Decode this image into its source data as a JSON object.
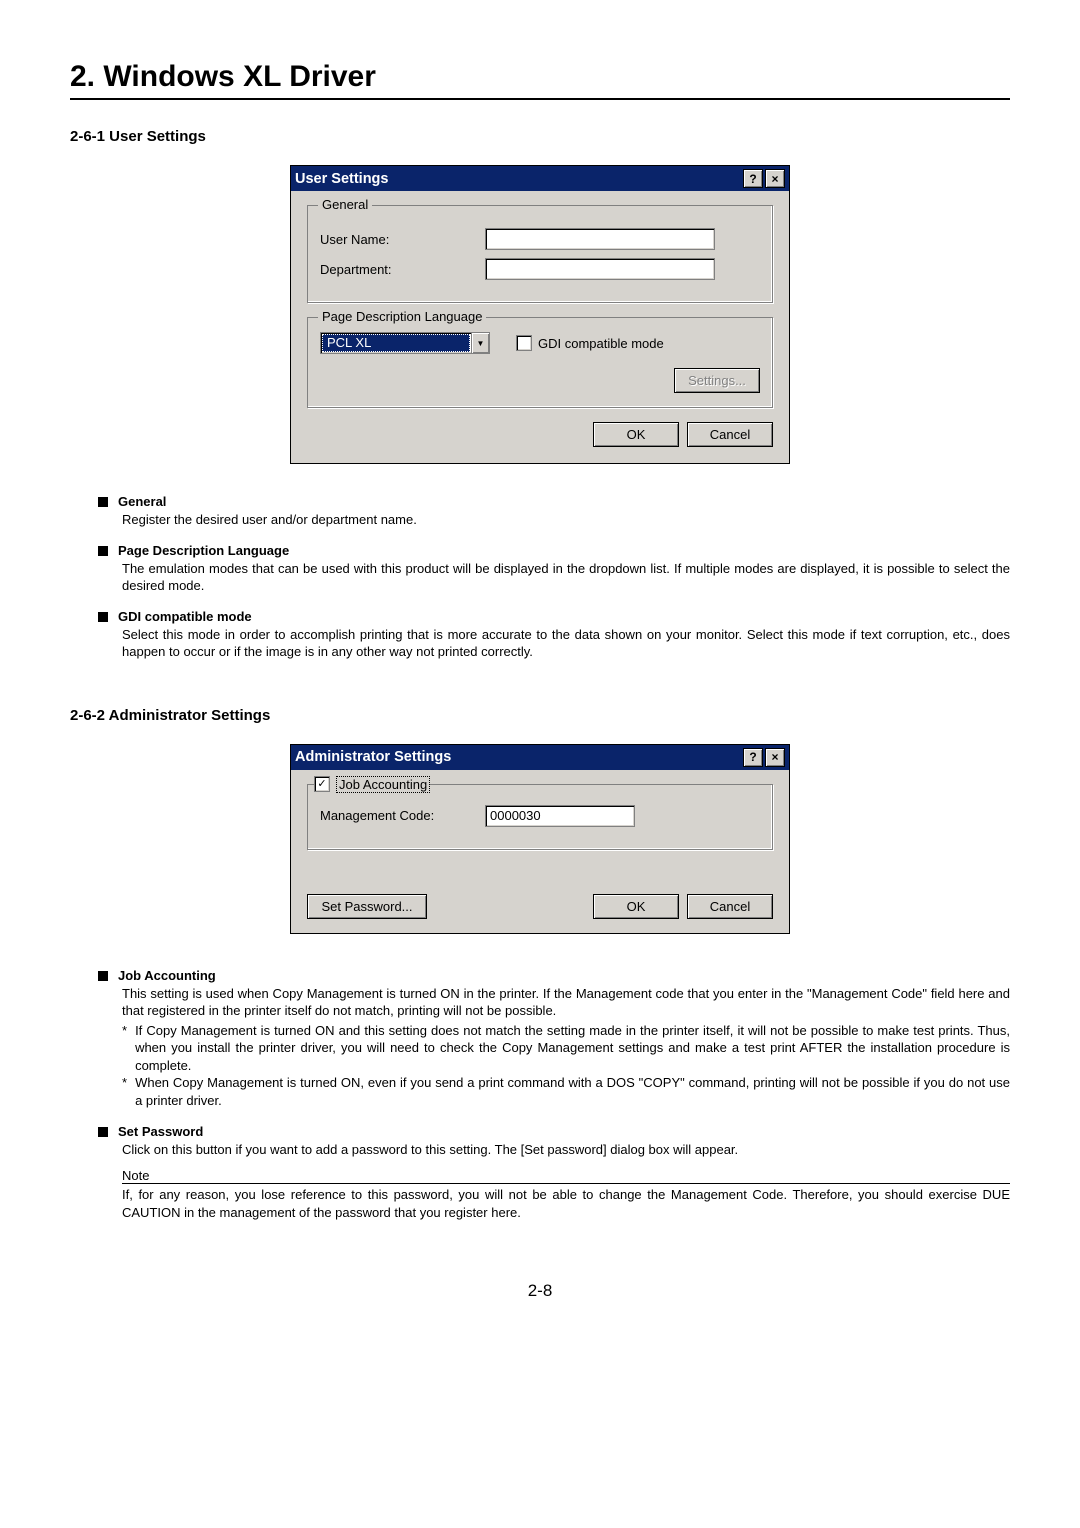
{
  "chapter_title": "2. Windows XL Driver",
  "section1": {
    "heading": "2-6-1 User Settings",
    "dialog": {
      "title": "User Settings",
      "group_general": "General",
      "user_name_label": "User Name:",
      "department_label": "Department:",
      "group_pdl": "Page Description Language",
      "pdl_value": "PCL XL",
      "gdi_label": "GDI compatible mode",
      "settings_button": "Settings...",
      "ok_button": "OK",
      "cancel_button": "Cancel"
    },
    "desc": {
      "general_title": "General",
      "general_body": "Register the desired user and/or department name.",
      "pdl_title": "Page Description Language",
      "pdl_body": "The emulation modes that can be used with this product will be displayed in the dropdown list. If multiple modes are displayed, it is possible to select the desired mode.",
      "gdi_title": "GDI compatible mode",
      "gdi_body": "Select this mode in order to accomplish printing that is more accurate to the data shown on your monitor. Select this mode if text corruption, etc., does happen to occur or if the image is in any other way not printed correctly."
    }
  },
  "section2": {
    "heading": "2-6-2 Administrator Settings",
    "dialog": {
      "title": "Administrator Settings",
      "job_accounting_label": "Job Accounting",
      "mgmt_code_label": "Management Code:",
      "mgmt_code_value": "0000030",
      "set_password_button": "Set Password...",
      "ok_button": "OK",
      "cancel_button": "Cancel"
    },
    "desc": {
      "job_acc_title": "Job Accounting",
      "job_acc_body": "This setting is used when Copy Management is turned ON in the printer. If the Management code that you enter in the \"Management Code\" field here and that registered in the printer itself do not match, printing will not be possible.",
      "ast1": "If Copy Management is turned ON and this setting does not match the setting made in the printer itself, it will not be possible to make test prints. Thus, when you install the printer driver, you will need to check the Copy Management settings and make a test print AFTER the installation procedure is complete.",
      "ast2": "When Copy Management is turned ON, even if you send a print command with a DOS \"COPY\" command, printing will not be possible if you do not use a printer driver.",
      "setpw_title": "Set Password",
      "setpw_body": "Click on this button if you want to add a password to this setting. The [Set password] dialog box will appear.",
      "note_word": "Note",
      "note_body": "If, for any reason, you lose reference to this password, you will not be able to change the Management Code. Therefore, you should exercise DUE CAUTION in the management of the password that you register here."
    }
  },
  "page_number": "2-8"
}
